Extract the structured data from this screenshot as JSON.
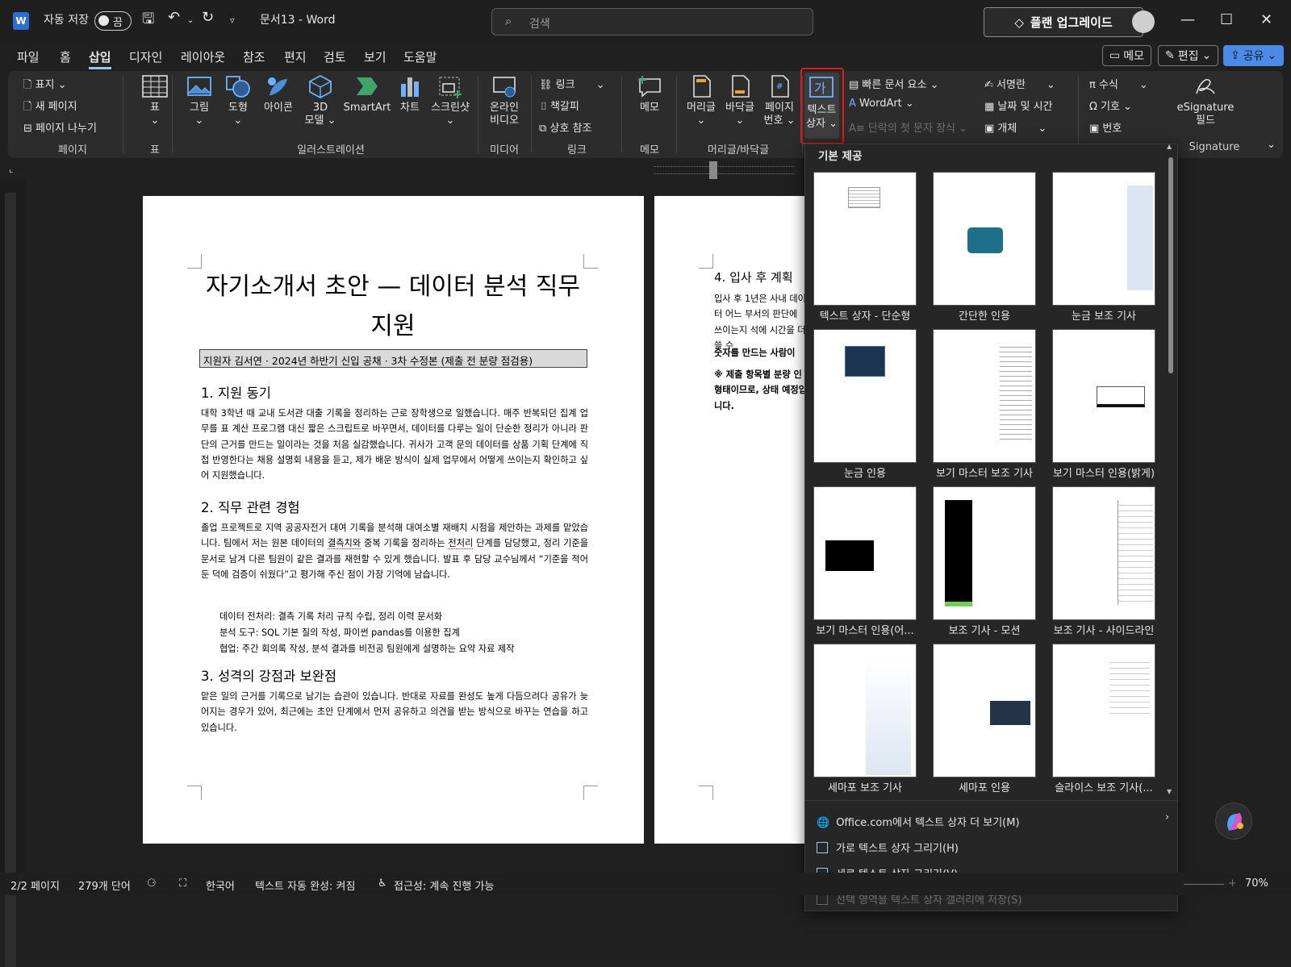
{
  "titlebar": {
    "autosave_label": "자동 저장",
    "autosave_state": "끔",
    "doc_name": "문서13 - Word",
    "search_placeholder": "검색",
    "upgrade_label": "플랜 업그레이드"
  },
  "menu": {
    "tabs": [
      "파일",
      "홈",
      "삽입",
      "디자인",
      "레이아웃",
      "참조",
      "편지",
      "검토",
      "보기",
      "도움말"
    ],
    "active_tab": "삽입",
    "memo_label": "메모",
    "edit_label": "편집",
    "share_label": "공유"
  },
  "ribbon": {
    "pages": {
      "cover": "표지",
      "new_page": "새 페이지",
      "page_break": "페이지 나누기",
      "group": "페이지"
    },
    "table": {
      "label": "표",
      "group": "표"
    },
    "illustrations": {
      "picture": "그림",
      "shapes": "도형",
      "icons": "아이콘",
      "model3d_1": "3D",
      "model3d_2": "모델",
      "smartart": "SmartArt",
      "chart": "차트",
      "screenshot": "스크린샷",
      "group": "일러스트레이션"
    },
    "media": {
      "online_video_1": "온라인",
      "online_video_2": "비디오",
      "group": "미디어"
    },
    "links": {
      "link": "링크",
      "bookmark": "책갈피",
      "crossref": "상호 참조",
      "group": "링크"
    },
    "comments": {
      "memo": "메모",
      "group": "메모"
    },
    "header_footer": {
      "header": "머리글",
      "footer": "바닥글",
      "page_no_1": "페이지",
      "page_no_2": "번호",
      "group": "머리글/바닥글"
    },
    "text": {
      "textbox_1": "텍스트",
      "textbox_2": "상자",
      "quick_parts": "빠른 문서 요소",
      "wordart": "WordArt",
      "dropcap": "단락의 첫 문자 장식",
      "signature": "서명란",
      "datetime": "날짜 및 시간",
      "object": "개체"
    },
    "symbols": {
      "equation": "수식",
      "symbol": "기호",
      "number": "번호"
    },
    "esig": {
      "line1": "eSignature",
      "line2": "필드",
      "group": "Signature"
    }
  },
  "document": {
    "page1": {
      "title": "자기소개서 초안 — 데이터 분석 직무 지원",
      "subtitle": "지원자 김서연 · 2024년 하반기 신입 공채 · 3차 수정본 (제출 전 분량 점검용)",
      "h1": "1. 지원 동기",
      "p1": "대학 3학년 때 교내 도서관 대출 기록을 정리하는 근로 장학생으로 일했습니다. 매주 반복되던 집계 업무를 표 계산 프로그램 대신 짧은 스크립트로 바꾸면서, 데이터를 다루는 일이 단순한 정리가 아니라 판단의 근거를 만드는 일이라는 것을 처음 실감했습니다. 귀사가 고객 문의 데이터를 상품 기획 단계에 직접 반영한다는 채용 설명회 내용을 듣고, 제가 배운 방식이 실제 업무에서 어떻게 쓰이는지 확인하고 싶어 지원했습니다.",
      "h2": "2. 직무 관련 경험",
      "p2_a": "졸업 프로젝트로 지역 공공자전거 대여 기록을 분석해 대여소별 재배치 시점을 제안하는 과제를 맡았습니다. 팀에서 저는 원본 데이터의 ",
      "p2_w1": "결측치와",
      "p2_b": " 중복 기록을 정리하는 ",
      "p2_w2": "전처리",
      "p2_c": " 단계를 담당했고, 정리 기준을 문서로 남겨 다른 팀원이 같은 결과를 재현할 수 있게 했습니다. 발표 후 담당 교수님께서 “기준을 적어 둔 덕에 검증이 쉬웠다”고 평가해 주신 점이 가장 기억에 남습니다.",
      "bullets": [
        "데이터 전처리: 결측 기록 처리 규칙 수립, 정리 이력 문서화",
        "분석 도구: SQL 기본 질의 작성, 파이썬 pandas를 이용한 집계",
        "협업: 주간 회의록 작성, 분석 결과를 비전공 팀원에게 설명하는 요약 자료 제작"
      ],
      "h3": "3. 성격의 강점과 보완점",
      "p3": "맡은 일의 근거를 기록으로 남기는 습관이 있습니다. 반대로 자료를 완성도 높게 다듬으려다 공유가 늦어지는 경우가 있어, 최근에는 초안 단계에서 먼저 공유하고 의견을 받는 방식으로 바꾸는 연습을 하고 있습니다."
    },
    "page2": {
      "h4": "4. 입사 후 계획",
      "p4": "입사 후 1년은 사내 데이터 어느 부서의 판단에 쓰이는지 석에 시간을 더 쓸 수",
      "bold1": "숫자를 만드는 사람이",
      "bold2": "※ 제출 항목별 분량 인 형태이므로, 상태 예정입니다."
    }
  },
  "gallery": {
    "header": "기본 제공",
    "tiles": [
      "텍스트 상자 - 단순형",
      "간단한 인용",
      "눈금 보조 기사",
      "눈금 인용",
      "보기 마스터 보조 기사",
      "보기 마스터 인용(밝게)",
      "보기 마스터 인용(어...",
      "보조 기사 - 모션",
      "보조 기사 - 사이드라인",
      "세마포 보조 기사",
      "세마포 인용",
      "슬라이스 보조 기사(..."
    ],
    "more": "Office.com에서 텍스트 상자 더 보기(M)",
    "draw_h": "가로 텍스트 상자 그리기(H)",
    "draw_v": "세로 텍스트 상자 그리기(V)",
    "save_sel": "선택 영역을 텍스트 상자 갤러리에 저장(S)"
  },
  "statusbar": {
    "pages": "2/2 페이지",
    "words": "279개 단어",
    "language": "한국어",
    "autocomplete": "텍스트 자동 완성: 켜짐",
    "accessibility": "접근성: 계속 진행 가능",
    "zoom": "70%"
  }
}
